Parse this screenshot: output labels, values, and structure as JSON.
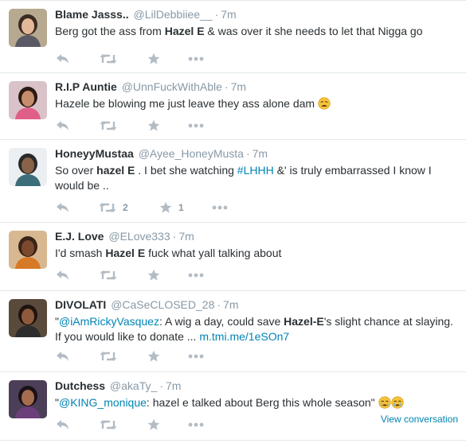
{
  "tweets": [
    {
      "name": "Blame Jasss..",
      "handle": "@LilDebbiiee__",
      "time": "7m",
      "segments": [
        {
          "t": "Berg got the ass from "
        },
        {
          "t": "Hazel E",
          "b": true
        },
        {
          "t": " & was over it she needs to let that Nigga go"
        }
      ],
      "retweets": "",
      "favorites": "",
      "avatar": {
        "bg": "#b7a98f",
        "hair": "#3b2c22",
        "skin": "#e3b89a",
        "shirt": "#5a5a66"
      }
    },
    {
      "name": "R.I.P Auntie",
      "handle": "@UnnFuckWithAble",
      "time": "7m",
      "segments": [
        {
          "t": "Hazele be blowing me just leave they ass alone dam "
        },
        {
          "emoji": "weary-face-emoji"
        }
      ],
      "retweets": "",
      "favorites": "",
      "avatar": {
        "bg": "#d9c3c8",
        "hair": "#2b1a14",
        "skin": "#c58d6c",
        "shirt": "#e05f88"
      }
    },
    {
      "name": "HoneyyMustaa",
      "handle": "@Ayee_HoneyMusta",
      "time": "7m",
      "segments": [
        {
          "t": "So over "
        },
        {
          "t": "hazel E",
          "b": true
        },
        {
          "t": " . I bet she watching "
        },
        {
          "t": "#LHHH",
          "link": true
        },
        {
          "t": " &' is truly embarrassed I know I would be .."
        }
      ],
      "retweets": "2",
      "favorites": "1",
      "avatar": {
        "bg": "#eceff1",
        "hair": "#2a2a2a",
        "skin": "#8a6248",
        "shirt": "#3c6e7a"
      }
    },
    {
      "name": "E.J. Love",
      "handle": "@ELove333",
      "time": "7m",
      "segments": [
        {
          "t": "I'd smash "
        },
        {
          "t": "Hazel E",
          "b": true
        },
        {
          "t": " fuck what yall talking about"
        }
      ],
      "retweets": "",
      "favorites": "",
      "avatar": {
        "bg": "#d8b890",
        "hair": "#3a2418",
        "skin": "#7b4a2e",
        "shirt": "#d77a28"
      }
    },
    {
      "name": "DIVOLATI",
      "handle": "@CaSeCLOSED_28",
      "time": "7m",
      "segments": [
        {
          "t": "\""
        },
        {
          "t": "@iAmRickyVasquez",
          "link": true
        },
        {
          "t": ": A wig a day, could save "
        },
        {
          "t": "Hazel-E",
          "b": true
        },
        {
          "t": "'s slight chance at slaying. If you would like to donate ... "
        },
        {
          "t": "m.tmi.me/1eSOn7",
          "link": true
        }
      ],
      "retweets": "",
      "favorites": "",
      "avatar": {
        "bg": "#5a4a3c",
        "hair": "#1d1410",
        "skin": "#8e5a3b",
        "shirt": "#2d2d2d"
      }
    },
    {
      "name": "Dutchess",
      "handle": "@akaTy_",
      "time": "7m",
      "segments": [
        {
          "t": "\""
        },
        {
          "t": "@KING_monique",
          "link": true
        },
        {
          "t": ": hazel e talked about Berg this whole season\" "
        },
        {
          "emoji": "crying-face-emoji"
        },
        {
          "emoji": "crying-face-emoji"
        }
      ],
      "retweets": "",
      "favorites": "",
      "view_conversation": "View conversation",
      "avatar": {
        "bg": "#4b3f57",
        "hair": "#1a1118",
        "skin": "#a56d4e",
        "shirt": "#6a3f7a"
      }
    }
  ]
}
